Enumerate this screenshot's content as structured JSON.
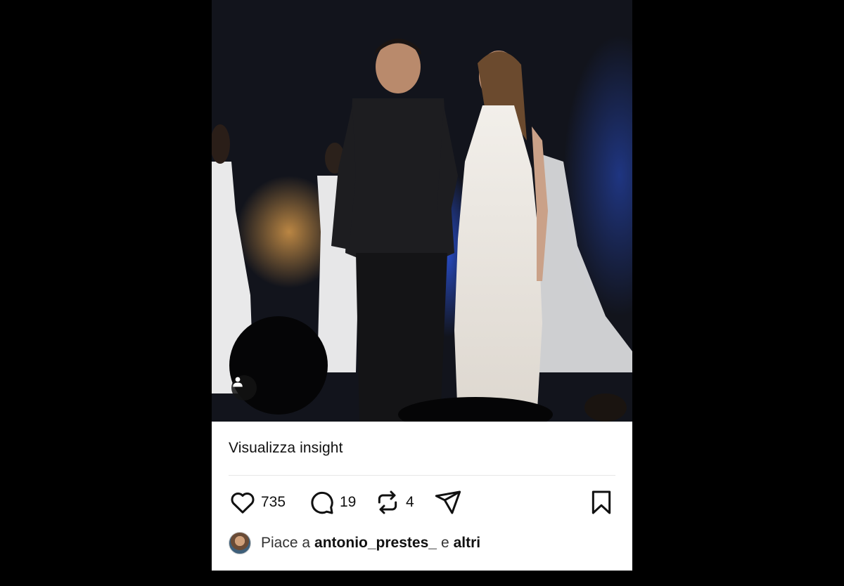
{
  "post": {
    "insight_label": "Visualizza insight",
    "likes": "735",
    "comments": "19",
    "reposts": "4",
    "liked_by_prefix": "Piace a",
    "liked_by_user": "antonio_prestes_",
    "liked_by_connector": "e",
    "liked_by_others": "altri"
  },
  "icons": {
    "like": "heart-icon",
    "comment": "comment-icon",
    "repost": "repost-icon",
    "share": "send-icon",
    "save": "bookmark-icon",
    "tag": "user-tag-icon"
  }
}
